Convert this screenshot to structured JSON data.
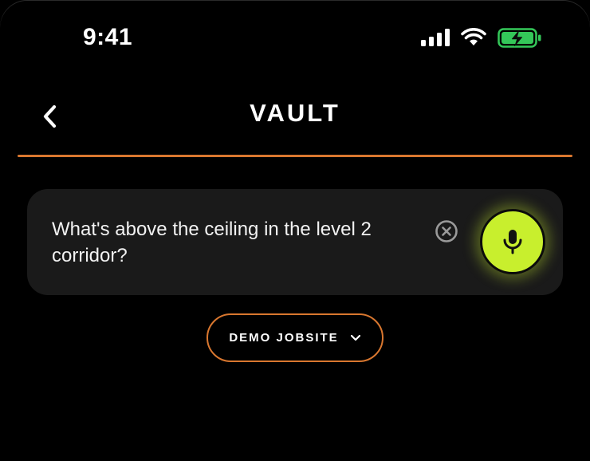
{
  "status_bar": {
    "time": "9:41",
    "icons": [
      "cellular-signal-icon",
      "wifi-icon",
      "battery-charging-icon"
    ],
    "battery_color": "#34c759"
  },
  "header": {
    "title": "VAULT",
    "back_icon": "chevron-left-icon"
  },
  "query": {
    "text": "What's above the ceiling in the level 2 corridor?",
    "clear_icon": "clear-circle-icon",
    "mic_icon": "microphone-icon"
  },
  "jobsite": {
    "selected": "DEMO JOBSITE",
    "dropdown_icon": "chevron-down-icon"
  },
  "colors": {
    "accent": "#d9772f",
    "mic": "#c8ef2d",
    "card": "#1a1a1a",
    "background": "#000000"
  }
}
